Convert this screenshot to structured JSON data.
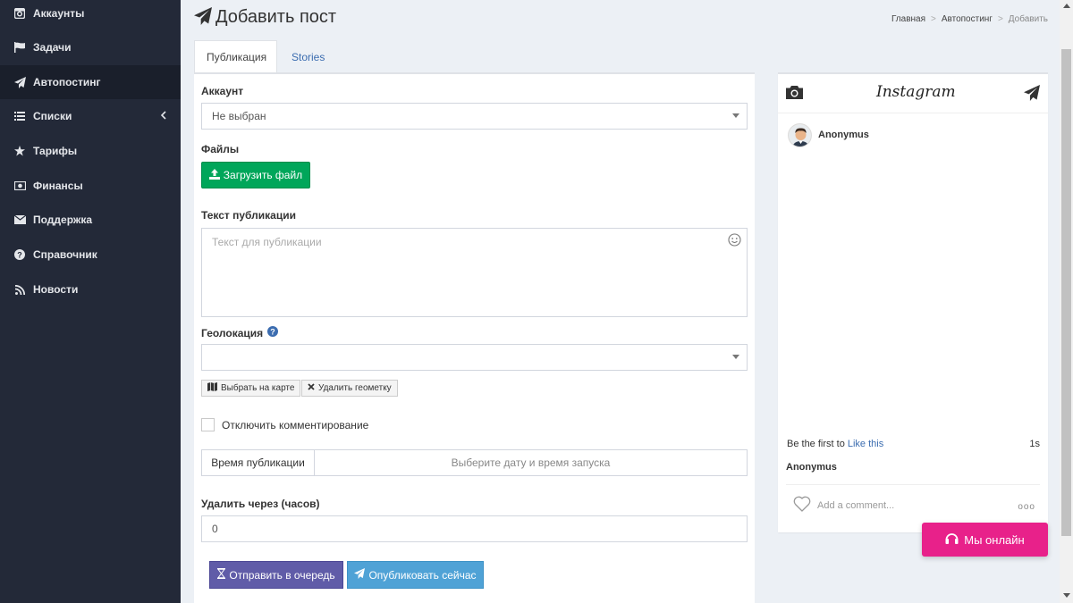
{
  "sidebar": {
    "items": [
      {
        "label": "Аккаунты",
        "icon": "instagram-icon"
      },
      {
        "label": "Задачи",
        "icon": "flag-icon"
      },
      {
        "label": "Автопостинг",
        "icon": "paper-plane-icon",
        "active": true
      },
      {
        "label": "Списки",
        "icon": "list-icon",
        "expandable": true
      },
      {
        "label": "Тарифы",
        "icon": "star-icon"
      },
      {
        "label": "Финансы",
        "icon": "money-icon"
      },
      {
        "label": "Поддержка",
        "icon": "envelope-icon"
      },
      {
        "label": "Справочник",
        "icon": "question-circle-icon"
      },
      {
        "label": "Новости",
        "icon": "rss-icon"
      }
    ]
  },
  "header": {
    "title": "Добавить пост",
    "breadcrumb": [
      "Главная",
      "Автопостинг",
      "Добавить"
    ]
  },
  "tabs": [
    {
      "label": "Публикация",
      "active": true
    },
    {
      "label": "Stories",
      "active": false
    }
  ],
  "form": {
    "account_label": "Аккаунт",
    "account_value": "Не выбран",
    "files_label": "Файлы",
    "upload_button": "Загрузить файл",
    "text_label": "Текст публикации",
    "text_placeholder": "Текст для публикации",
    "geo_label": "Геолокация",
    "geo_value": "",
    "map_button": "Выбрать на карте",
    "remove_geo_button": "Удалить геометку",
    "disable_comments_label": "Отключить комментирование",
    "disable_comments_checked": false,
    "pub_time_addon": "Время публикации",
    "pub_time_placeholder": "Выберите дату и время запуска",
    "delete_after_label": "Удалить через (часов)",
    "delete_after_value": "0",
    "queue_button": "Отправить в очередь",
    "publish_button": "Опубликовать сейчас"
  },
  "preview": {
    "logo": "Instagram",
    "username": "Anonymus",
    "like_prefix": "Be the first to ",
    "like_link": "Like this",
    "time": "1s",
    "caption_user": "Anonymus",
    "comment_placeholder": "Add a comment...",
    "dots": "ooo"
  },
  "online_button": "Мы онлайн",
  "colors": {
    "sidebar_bg": "#232938",
    "success": "#00a65a",
    "purple": "#605ca8",
    "info": "#4fa2d6",
    "pink": "#e8218a",
    "link": "#3c6db0"
  }
}
